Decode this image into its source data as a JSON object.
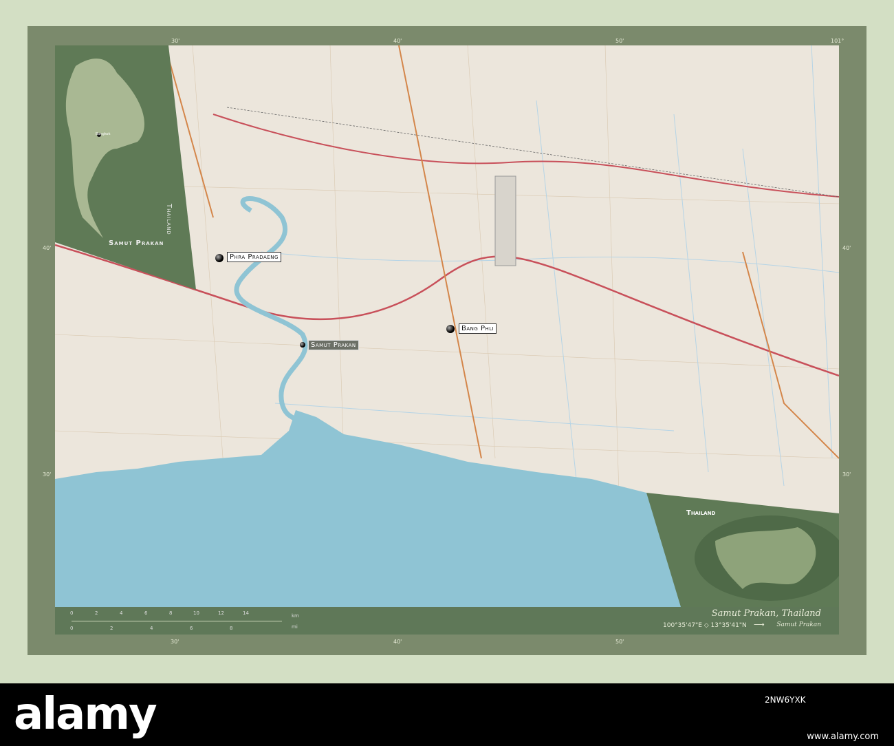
{
  "map": {
    "title": "Samut Prakan, Thailand",
    "coordinates": "100°35'47\"E ◇ 13°35'41\"N",
    "arrow": "⟶",
    "region": "Samut Prakan",
    "places": [
      {
        "name": "Phra Pradaeng",
        "style": "box"
      },
      {
        "name": "Bang Phli",
        "style": "box"
      },
      {
        "name": "Samut Prakan",
        "style": "dark"
      }
    ],
    "grid_labels": {
      "top": [
        "30'",
        "40'",
        "50'",
        "101°"
      ],
      "left": [
        "40'",
        "30'"
      ],
      "right": [
        "40'",
        "30'"
      ],
      "bottom": [
        "30'",
        "40'",
        "50'"
      ]
    }
  },
  "inset_country": {
    "country_label": "Thailand",
    "region_label": "Samut Prakan",
    "capital": "Bangkok"
  },
  "inset_world": {
    "label": "Thailand"
  },
  "scale": {
    "km_ticks": [
      "0",
      "2",
      "4",
      "6",
      "8",
      "10",
      "12",
      "14"
    ],
    "km_unit": "km",
    "mi_ticks": [
      "0",
      "2",
      "4",
      "6",
      "8"
    ],
    "mi_unit": "mi"
  },
  "watermark": {
    "brand": "alamy",
    "image_code": "2NW6YXK",
    "footer": "www.alamy.com"
  },
  "colors": {
    "sea": "#8fc4d4",
    "land": "#ece6dc",
    "frame": "#7b8a6c",
    "inset": "#5f7a56"
  }
}
